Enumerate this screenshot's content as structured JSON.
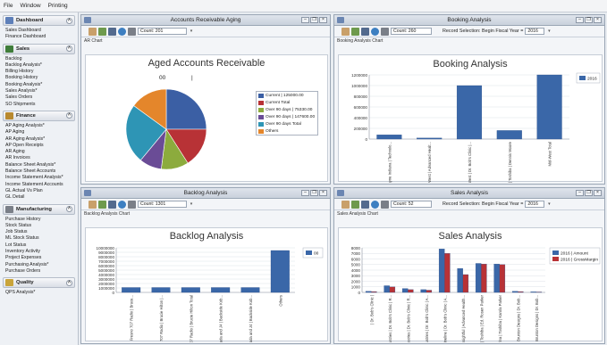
{
  "menu": [
    "File",
    "Window",
    "Printing"
  ],
  "sidebar": {
    "sections": [
      {
        "title": "Dashboard",
        "color": "#5d7fb9",
        "items": [
          "Sales Dashboard",
          "Finance Dashboard"
        ]
      },
      {
        "title": "Sales",
        "color": "#3f7d3a",
        "items": [
          "Backlog",
          "Backlog Analysis*",
          "Billing History",
          "Booking History",
          "Booking Analysis*",
          "Sales Analysis*",
          "Sales Orders",
          "SO Shipments"
        ]
      },
      {
        "title": "Finance",
        "color": "#b8892f",
        "items": [
          "AP Aging Analysis*",
          "AP Aging",
          "AR Aging Analysis*",
          "AP Open Receipts",
          "AR Aging",
          "AR Invoices",
          "Balance Sheet Analysis*",
          "Balance Sheet Accounts",
          "Income Statement Analysis*",
          "Income Statement Accounts",
          "GL Actual Vs Plan",
          "GL Detail"
        ]
      },
      {
        "title": "Manufacturing",
        "color": "#7a7f88",
        "items": [
          "Purchase History",
          "Stock Status",
          "Job Status",
          "ML Stock Status",
          "Lot Status",
          "Inventory Activity",
          "Project Expenses",
          "Purchasing Analysis*",
          "Purchase Orders"
        ]
      },
      {
        "title": "Quality",
        "color": "#c9a43a",
        "items": []
      }
    ],
    "footer_item": "QPS Analysis*"
  },
  "panels": {
    "ar": {
      "title": "Accounts Receivable Aging",
      "count": "Count: 201",
      "chart_label": "AR Chart",
      "chart_title": "Aged Accounts Receivable",
      "top_labels": [
        "00",
        "|"
      ]
    },
    "booking": {
      "title": "Booking Analysis",
      "count": "Count: 260",
      "record_selection_label": "Record Selection: Begin Fiscal Year =",
      "year": "2016",
      "chart_label": "Booking Analysis Chart",
      "chart_title": "Booking Analysis"
    },
    "backlog": {
      "title": "Backlog Analysis",
      "count": "Count: 1301",
      "chart_label": "Backlog Analysis Chart",
      "chart_title": "Backlog Analysis"
    },
    "sales": {
      "title": "Sales Analysis",
      "count": "Count: 52",
      "record_selection_label": "Record Selection: Begin Fiscal Year =",
      "year": "2016",
      "chart_label": "Sales Analysis Chart",
      "chart_title": "Sales Analysis"
    }
  },
  "chart_data": [
    {
      "type": "pie",
      "title": "Aged Accounts Receivable",
      "categories": [
        "Current | 125000.00",
        "Current  Total",
        "Over 90 days | 75330.00",
        "Over 90 days | 147600.00",
        "Over 90 days Total",
        "Others"
      ],
      "values": [
        25,
        16,
        11,
        9,
        24,
        15
      ],
      "colors": [
        "#3b5fa4",
        "#b83236",
        "#8cab3d",
        "#6a4c96",
        "#2e95b5",
        "#e4862b"
      ]
    },
    {
      "type": "bar",
      "title": "Booking Analysis",
      "categories": [
        "Fort Wayne Indiana | Technolo...",
        "Mid-West | Advanced Healt...",
        "Mid-West | Dr. Bob's Clinic |...",
        "Mid-West | Toshiba | Dennis Moore",
        "Mid-West Total"
      ],
      "series": [
        {
          "name": "2016",
          "values": [
            80000,
            20000,
            1000000,
            160000,
            1200000
          ]
        }
      ],
      "ylim": [
        0,
        1200000
      ],
      "yticks": [
        0,
        200000,
        400000,
        600000,
        800000,
        1000000,
        1200000
      ],
      "colors": [
        "#3a67a8"
      ]
    },
    {
      "type": "bar",
      "title": "Backlog Analysis",
      "categories": [
        "Fresno 707 Radio | Bruce...",
        "Fresno 707 Radio | Brucie Hilton |...",
        "Fresno 707 Radio | Brucie Hilton Total",
        "Tejada and J4 | Backside Kob...",
        "Tejada and J4 | Backside Kob...",
        "Others"
      ],
      "series": [
        {
          "name": "00",
          "values": [
            1100000,
            1100000,
            1100000,
            1100000,
            1100000,
            9400000
          ]
        }
      ],
      "ylim": [
        0,
        10000000
      ],
      "yticks": [
        0,
        1000000,
        2000000,
        3000000,
        4000000,
        5000000,
        6000000,
        7000000,
        8000000,
        9000000,
        10000000
      ],
      "colors": [
        "#3a67a8"
      ]
    },
    {
      "type": "bar",
      "title": "Sales Analysis",
      "categories": [
        "| Dr. Bob's Clinic |",
        "BP Industries | Dr. Bob's Clinic | R...",
        "BP Industries | Dr. Bob's Clinic | R...",
        "BP Industries | Dr. Bob's Clinic | A...",
        "Fineline | Dr. Bob's Clinic | A...",
        "Insightful | Advanced Health...",
        "Katerina | Toshiba | Ed. Rosen Parker",
        "Katerina | Toshiba | Karola Parker",
        "Paul Brunton Designs | Dr. Bob...",
        "Paul Brunton Designs | Dr. Bob..."
      ],
      "series": [
        {
          "name": "2016 | Amount",
          "values": [
            200,
            1200,
            700,
            500,
            7800,
            4300,
            5200,
            5100,
            200,
            100
          ]
        },
        {
          "name": "2016 | GrossMargin",
          "values": [
            150,
            1000,
            500,
            400,
            7000,
            3200,
            5100,
            5000,
            150,
            80
          ]
        }
      ],
      "ylim": [
        0,
        8000
      ],
      "yticks": [
        0,
        1000,
        2000,
        3000,
        4000,
        5000,
        6000,
        7000,
        8000
      ],
      "colors": [
        "#3a67a8",
        "#b83236"
      ]
    }
  ]
}
